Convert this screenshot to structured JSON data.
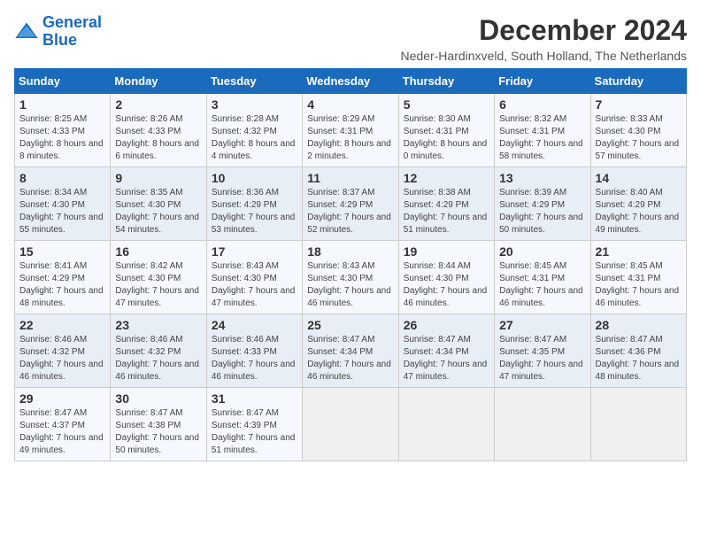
{
  "header": {
    "logo_general": "General",
    "logo_blue": "Blue",
    "title": "December 2024",
    "subtitle": "Neder-Hardinxveld, South Holland, The Netherlands"
  },
  "days_of_week": [
    "Sunday",
    "Monday",
    "Tuesday",
    "Wednesday",
    "Thursday",
    "Friday",
    "Saturday"
  ],
  "weeks": [
    [
      {
        "day": "1",
        "sunrise": "Sunrise: 8:25 AM",
        "sunset": "Sunset: 4:33 PM",
        "daylight": "Daylight: 8 hours and 8 minutes."
      },
      {
        "day": "2",
        "sunrise": "Sunrise: 8:26 AM",
        "sunset": "Sunset: 4:33 PM",
        "daylight": "Daylight: 8 hours and 6 minutes."
      },
      {
        "day": "3",
        "sunrise": "Sunrise: 8:28 AM",
        "sunset": "Sunset: 4:32 PM",
        "daylight": "Daylight: 8 hours and 4 minutes."
      },
      {
        "day": "4",
        "sunrise": "Sunrise: 8:29 AM",
        "sunset": "Sunset: 4:31 PM",
        "daylight": "Daylight: 8 hours and 2 minutes."
      },
      {
        "day": "5",
        "sunrise": "Sunrise: 8:30 AM",
        "sunset": "Sunset: 4:31 PM",
        "daylight": "Daylight: 8 hours and 0 minutes."
      },
      {
        "day": "6",
        "sunrise": "Sunrise: 8:32 AM",
        "sunset": "Sunset: 4:31 PM",
        "daylight": "Daylight: 7 hours and 58 minutes."
      },
      {
        "day": "7",
        "sunrise": "Sunrise: 8:33 AM",
        "sunset": "Sunset: 4:30 PM",
        "daylight": "Daylight: 7 hours and 57 minutes."
      }
    ],
    [
      {
        "day": "8",
        "sunrise": "Sunrise: 8:34 AM",
        "sunset": "Sunset: 4:30 PM",
        "daylight": "Daylight: 7 hours and 55 minutes."
      },
      {
        "day": "9",
        "sunrise": "Sunrise: 8:35 AM",
        "sunset": "Sunset: 4:30 PM",
        "daylight": "Daylight: 7 hours and 54 minutes."
      },
      {
        "day": "10",
        "sunrise": "Sunrise: 8:36 AM",
        "sunset": "Sunset: 4:29 PM",
        "daylight": "Daylight: 7 hours and 53 minutes."
      },
      {
        "day": "11",
        "sunrise": "Sunrise: 8:37 AM",
        "sunset": "Sunset: 4:29 PM",
        "daylight": "Daylight: 7 hours and 52 minutes."
      },
      {
        "day": "12",
        "sunrise": "Sunrise: 8:38 AM",
        "sunset": "Sunset: 4:29 PM",
        "daylight": "Daylight: 7 hours and 51 minutes."
      },
      {
        "day": "13",
        "sunrise": "Sunrise: 8:39 AM",
        "sunset": "Sunset: 4:29 PM",
        "daylight": "Daylight: 7 hours and 50 minutes."
      },
      {
        "day": "14",
        "sunrise": "Sunrise: 8:40 AM",
        "sunset": "Sunset: 4:29 PM",
        "daylight": "Daylight: 7 hours and 49 minutes."
      }
    ],
    [
      {
        "day": "15",
        "sunrise": "Sunrise: 8:41 AM",
        "sunset": "Sunset: 4:29 PM",
        "daylight": "Daylight: 7 hours and 48 minutes."
      },
      {
        "day": "16",
        "sunrise": "Sunrise: 8:42 AM",
        "sunset": "Sunset: 4:30 PM",
        "daylight": "Daylight: 7 hours and 47 minutes."
      },
      {
        "day": "17",
        "sunrise": "Sunrise: 8:43 AM",
        "sunset": "Sunset: 4:30 PM",
        "daylight": "Daylight: 7 hours and 47 minutes."
      },
      {
        "day": "18",
        "sunrise": "Sunrise: 8:43 AM",
        "sunset": "Sunset: 4:30 PM",
        "daylight": "Daylight: 7 hours and 46 minutes."
      },
      {
        "day": "19",
        "sunrise": "Sunrise: 8:44 AM",
        "sunset": "Sunset: 4:30 PM",
        "daylight": "Daylight: 7 hours and 46 minutes."
      },
      {
        "day": "20",
        "sunrise": "Sunrise: 8:45 AM",
        "sunset": "Sunset: 4:31 PM",
        "daylight": "Daylight: 7 hours and 46 minutes."
      },
      {
        "day": "21",
        "sunrise": "Sunrise: 8:45 AM",
        "sunset": "Sunset: 4:31 PM",
        "daylight": "Daylight: 7 hours and 46 minutes."
      }
    ],
    [
      {
        "day": "22",
        "sunrise": "Sunrise: 8:46 AM",
        "sunset": "Sunset: 4:32 PM",
        "daylight": "Daylight: 7 hours and 46 minutes."
      },
      {
        "day": "23",
        "sunrise": "Sunrise: 8:46 AM",
        "sunset": "Sunset: 4:32 PM",
        "daylight": "Daylight: 7 hours and 46 minutes."
      },
      {
        "day": "24",
        "sunrise": "Sunrise: 8:46 AM",
        "sunset": "Sunset: 4:33 PM",
        "daylight": "Daylight: 7 hours and 46 minutes."
      },
      {
        "day": "25",
        "sunrise": "Sunrise: 8:47 AM",
        "sunset": "Sunset: 4:34 PM",
        "daylight": "Daylight: 7 hours and 46 minutes."
      },
      {
        "day": "26",
        "sunrise": "Sunrise: 8:47 AM",
        "sunset": "Sunset: 4:34 PM",
        "daylight": "Daylight: 7 hours and 47 minutes."
      },
      {
        "day": "27",
        "sunrise": "Sunrise: 8:47 AM",
        "sunset": "Sunset: 4:35 PM",
        "daylight": "Daylight: 7 hours and 47 minutes."
      },
      {
        "day": "28",
        "sunrise": "Sunrise: 8:47 AM",
        "sunset": "Sunset: 4:36 PM",
        "daylight": "Daylight: 7 hours and 48 minutes."
      }
    ],
    [
      {
        "day": "29",
        "sunrise": "Sunrise: 8:47 AM",
        "sunset": "Sunset: 4:37 PM",
        "daylight": "Daylight: 7 hours and 49 minutes."
      },
      {
        "day": "30",
        "sunrise": "Sunrise: 8:47 AM",
        "sunset": "Sunset: 4:38 PM",
        "daylight": "Daylight: 7 hours and 50 minutes."
      },
      {
        "day": "31",
        "sunrise": "Sunrise: 8:47 AM",
        "sunset": "Sunset: 4:39 PM",
        "daylight": "Daylight: 7 hours and 51 minutes."
      },
      null,
      null,
      null,
      null
    ]
  ]
}
